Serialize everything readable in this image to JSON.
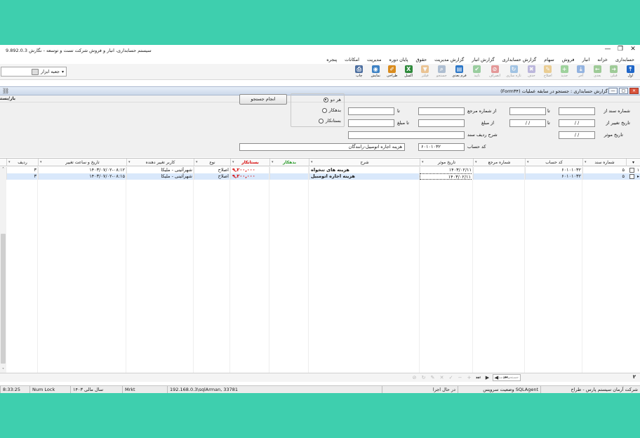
{
  "window": {
    "title": "سیستم حسابداری، انبار و فروش شرکت تست و توسعه - نگارش 9.892.0.3",
    "controls": [
      "✕",
      "❐",
      "—"
    ]
  },
  "menu": [
    "حسابداری",
    "خزانه",
    "انبار",
    "فروش",
    "سهام",
    "گزارش حسابداری",
    "گزارش انبار",
    "گزارش مدیریت",
    "حقوق",
    "پایان دوره",
    "مدیریت",
    "امکانات",
    "پنجره"
  ],
  "toolbar": {
    "buttons": [
      {
        "label": "اول",
        "icon": "first-arrow-icon",
        "color": "#1f66c8",
        "glyph": "⤒",
        "enabled": true
      },
      {
        "label": "قبلی",
        "icon": "prev-arrow-icon",
        "color": "#3a9a2b",
        "glyph": "➜",
        "enabled": false
      },
      {
        "label": "بعدی",
        "icon": "next-arrow-icon",
        "color": "#3a9a2b",
        "glyph": "←",
        "enabled": false
      },
      {
        "label": "آخر",
        "icon": "last-arrow-icon",
        "color": "#1f66c8",
        "glyph": "⤓",
        "enabled": false
      },
      {
        "label": "جدید",
        "icon": "add-icon",
        "color": "#3aa935",
        "glyph": "+",
        "enabled": false
      },
      {
        "label": "اصلاح",
        "icon": "edit-icon",
        "color": "#e0a020",
        "glyph": "✎",
        "enabled": false
      },
      {
        "label": "حذف",
        "icon": "delete-icon",
        "color": "#7a6fc0",
        "glyph": "✖",
        "enabled": false
      },
      {
        "label": "تازه سازی",
        "icon": "refresh-icon",
        "color": "#3f88cf",
        "glyph": "↻",
        "enabled": false
      },
      {
        "label": "انصراف",
        "icon": "cancel-icon",
        "color": "#d22b2b",
        "glyph": "⊘",
        "enabled": false
      },
      {
        "label": "تایید",
        "icon": "confirm-icon",
        "color": "#2f9e3a",
        "glyph": "✔",
        "enabled": false
      },
      {
        "label": "فرم بعدی",
        "icon": "next-form-icon",
        "color": "#2e78c8",
        "glyph": "▤",
        "enabled": true
      },
      {
        "label": "جستجو",
        "icon": "search-icon",
        "color": "#5a7ea8",
        "glyph": "⌕",
        "enabled": false
      },
      {
        "label": "فیلتر",
        "icon": "filter-icon",
        "color": "#e08a1e",
        "glyph": "▼",
        "enabled": false
      },
      {
        "label": "اکسل",
        "icon": "excel-icon",
        "color": "#2f8a3c",
        "glyph": "X",
        "enabled": true
      },
      {
        "label": "طراحی",
        "icon": "design-icon",
        "color": "#d98b1d",
        "glyph": "✐",
        "enabled": true
      },
      {
        "label": "نمایش",
        "icon": "preview-icon",
        "color": "#3e82c4",
        "glyph": "◉",
        "enabled": true
      },
      {
        "label": "چاپ",
        "icon": "print-icon",
        "color": "#4d6fa0",
        "glyph": "⎙",
        "enabled": true
      }
    ],
    "toolbox_label": "جعبه ابزار",
    "toolbox_arrow": "▾"
  },
  "child_window": {
    "title": "گزارش حسابداری : جستجو در سابقه عملیات (Form۳۴)",
    "icon_glyph": "⛓",
    "controls": [
      "✕",
      "▢",
      "—"
    ]
  },
  "section_title": "باز/بسته",
  "filter": {
    "doc_no_from_label": "شماره سند از",
    "doc_no_to_label": "تا",
    "doc_no_from": "",
    "doc_no_to": "",
    "ref_no_from_label": "از شماره مرجع",
    "ref_no_to_label": "تا",
    "ref_no_from": "",
    "ref_no_to": "",
    "change_date_from_label": "تاریخ تغییر از",
    "change_date_to_label": "تا",
    "change_date_from": "/ /",
    "change_date_to": "/ /",
    "amount_from_label": "از مبلغ",
    "amount_to_label": "تا مبلغ",
    "amount_from": "",
    "amount_to": "",
    "effective_date_label": "تاریخ موثر",
    "effective_date": "/ /",
    "line_desc_label": "شرح ردیف سند",
    "line_desc": "",
    "account_code_label": "کد حساب",
    "account_code": "۶۰۱۰۱۰۳۲",
    "account_name": "هزینه اجاره اتومبیل-رانندگان",
    "radios": [
      {
        "label": "هر دو",
        "checked": true
      },
      {
        "label": "بدهکار",
        "checked": false
      },
      {
        "label": "بستانکار",
        "checked": false
      }
    ],
    "search_button": "انجام جستجو"
  },
  "grid": {
    "columns": [
      {
        "key": "doc_no",
        "label": "شماره سند"
      },
      {
        "key": "account_code",
        "label": "کد حساب"
      },
      {
        "key": "ref_no",
        "label": "شماره مرجع"
      },
      {
        "key": "effective_date",
        "label": "تاریخ موثر"
      },
      {
        "key": "description",
        "label": "شرح"
      },
      {
        "key": "debit",
        "label": "بدهکار"
      },
      {
        "key": "credit",
        "label": "بستانکار"
      },
      {
        "key": "type",
        "label": "نوع"
      },
      {
        "key": "changed_by",
        "label": "کاربر تغییر دهنده"
      },
      {
        "key": "changed_at",
        "label": "تاریخ و ساعت تغییر"
      },
      {
        "key": "row",
        "label": "ردیف"
      }
    ],
    "debit_color": "#2a9a2a",
    "credit_color": "#d40000",
    "rows": [
      {
        "index": "۱",
        "doc_no": "۵",
        "account_code": "۶۰۱۰۱۰۳۲",
        "ref_no": "",
        "effective_date": "۱۴۰۳/۰۲/۱۱",
        "description": "هزینه های تنخواه",
        "debit": "",
        "credit": "۹,۲۰۰,۰۰۰",
        "type": "اصلاح",
        "changed_by": "شهرآئینی - ملیکا",
        "changed_at": "۱۴۰۳/۰۷/۰۲-۰۸:۱۲",
        "row": "۳"
      },
      {
        "index": "▸",
        "doc_no": "۵",
        "account_code": "۶۰۱۰۱۰۳۲",
        "ref_no": "",
        "effective_date": "۱۴۰۳/۰۲/۱۱",
        "description": "هزینه اجاره اتومبیل",
        "debit": "",
        "credit": "۹,۲۰۰,۰۰۰",
        "type": "اصلاح",
        "changed_by": "شهرآئینی - ملیکا",
        "changed_at": "۱۴۰۳/۰۷/۰۲-۰۸:۱۵",
        "row": "۳"
      }
    ]
  },
  "navbar": {
    "record_indicator": "۲",
    "search_placeholder": "جستجو در ستون انتخاب",
    "buttons": [
      "⏮",
      "◀",
      "▶",
      "⏭",
      "+",
      "−",
      "✓",
      "✕",
      "✎",
      "↻",
      "⊘"
    ]
  },
  "status": {
    "company": "شرکت آرمان سیستم پارس - طراح",
    "service_status": "SQLAgent وضعیت سرویس",
    "server": "در حال اجرا",
    "connection": "192.168.0.3\\sqlArman, 33781",
    "mode": "Mrkt",
    "fiscal_year": "سال مالی ۱۴۰۳",
    "num_lock": "Num Lock",
    "time": "8:33:25"
  }
}
